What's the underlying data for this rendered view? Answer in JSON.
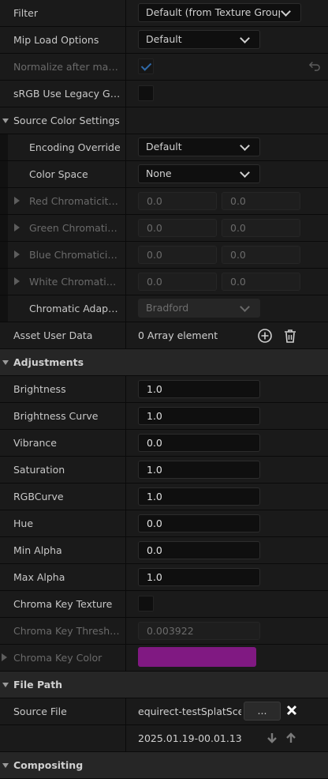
{
  "texture_group": {
    "filter_label": "Filter",
    "filter_value": "Default (from Texture Group)",
    "mip_label": "Mip Load Options",
    "mip_value": "Default",
    "normalize_label": "Normalize after makin...",
    "normalize_checked": true,
    "srgb_label": "sRGB Use Legacy Ga...",
    "srgb_checked": false
  },
  "source_color": {
    "header": "Source Color Settings",
    "encoding_label": "Encoding Override",
    "encoding_value": "Default",
    "colorspace_label": "Color Space",
    "colorspace_value": "None",
    "chroma_rows": [
      {
        "label": "Red Chromaticity C...",
        "v1": "0.0",
        "v2": "0.0"
      },
      {
        "label": "Green Chromaticit...",
        "v1": "0.0",
        "v2": "0.0"
      },
      {
        "label": "Blue Chromaticity...",
        "v1": "0.0",
        "v2": "0.0"
      },
      {
        "label": "White Chromaticity...",
        "v1": "0.0",
        "v2": "0.0"
      }
    ],
    "adaptation_label": "Chromatic Adaptati...",
    "adaptation_value": "Bradford"
  },
  "asset_user_data": {
    "label": "Asset User Data",
    "value": "0 Array element"
  },
  "adjustments": {
    "header": "Adjustments",
    "rows": [
      {
        "label": "Brightness",
        "value": "1.0"
      },
      {
        "label": "Brightness Curve",
        "value": "1.0"
      },
      {
        "label": "Vibrance",
        "value": "0.0"
      },
      {
        "label": "Saturation",
        "value": "1.0"
      },
      {
        "label": "RGBCurve",
        "value": "1.0"
      },
      {
        "label": "Hue",
        "value": "0.0"
      },
      {
        "label": "Min Alpha",
        "value": "0.0"
      },
      {
        "label": "Max Alpha",
        "value": "1.0"
      }
    ],
    "chroma_key_texture_label": "Chroma Key Texture",
    "chroma_key_threshold_label": "Chroma Key Threshold",
    "chroma_key_threshold_value": "0.003922",
    "chroma_key_color_label": "Chroma Key Color",
    "chroma_key_color": "#8c1a8e"
  },
  "file_path": {
    "header": "File Path",
    "source_file_label": "Source File",
    "source_file_value": "equirect-testSplatScen",
    "browse_label": "...",
    "timestamp": "2025.01.19-00.01.13"
  },
  "compositing": {
    "header": "Compositing"
  }
}
